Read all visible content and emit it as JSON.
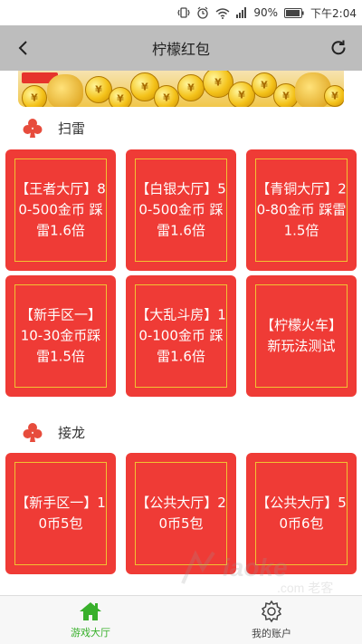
{
  "status_bar": {
    "battery_percent": "90%",
    "time": "下午2:04",
    "icons": [
      "vibrate-icon",
      "alarm-icon",
      "wifi-icon",
      "signal-icon",
      "battery-icon"
    ]
  },
  "app_bar": {
    "title": "柠檬红包",
    "back_icon": "back-arrow-icon",
    "refresh_icon": "refresh-icon"
  },
  "banner": {
    "coin_symbol": "¥"
  },
  "sections": [
    {
      "title": "扫雷",
      "icon": "club-icon",
      "rooms": [
        {
          "text": "【王者大厅】80-500金币 踩雷1.6倍"
        },
        {
          "text": "【白银大厅】50-500金币 踩雷1.6倍"
        },
        {
          "text": "【青铜大厅】20-80金币 踩雷1.5倍"
        },
        {
          "text": "【新手区一】 10-30金币踩雷1.5倍"
        },
        {
          "text": "【大乱斗房】10-100金币 踩雷1.6倍"
        },
        {
          "text": "【柠檬火车】新玩法测试"
        }
      ]
    },
    {
      "title": "接龙",
      "icon": "club-icon",
      "rooms": [
        {
          "text": "【新手区一】10币5包"
        },
        {
          "text": "【公共大厅】20币5包"
        },
        {
          "text": "【公共大厅】50币6包"
        }
      ]
    }
  ],
  "watermark": {
    "text": "iaoke",
    "subtext": ".com 老客"
  },
  "bottom_nav": [
    {
      "label": "游戏大厅",
      "icon": "home-icon",
      "active": true
    },
    {
      "label": "我的账户",
      "icon": "gear-icon",
      "active": false
    }
  ],
  "colors": {
    "card_red": "#ef3b36",
    "card_border": "#f1c232",
    "app_bar": "#bdbdbd",
    "club_red": "#e74c3c",
    "nav_active": "#38b02b"
  }
}
